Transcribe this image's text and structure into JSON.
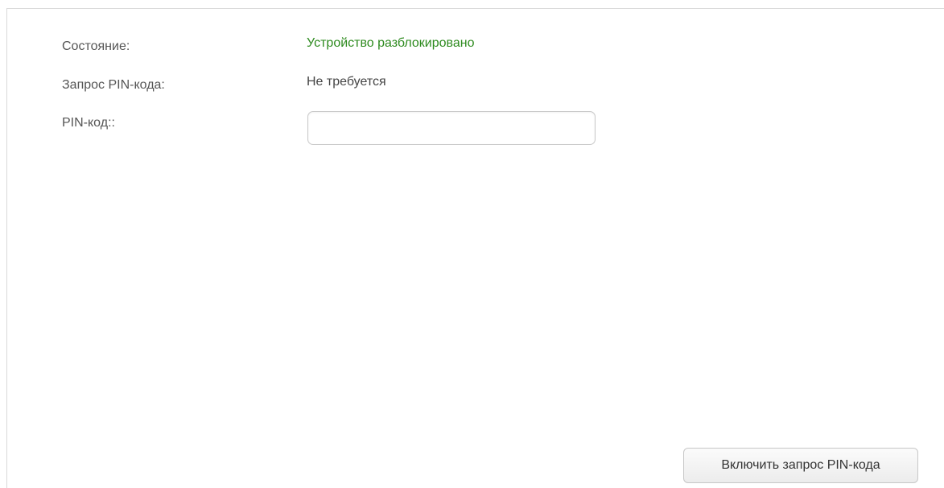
{
  "status": {
    "label": "Состояние:",
    "value": "Устройство разблокировано",
    "value_color": "#2e8b1f"
  },
  "pin_request": {
    "label": "Запрос PIN-кода:",
    "value": "Не требуется"
  },
  "pin_code": {
    "label": "PIN-код::",
    "value": "",
    "placeholder": ""
  },
  "actions": {
    "enable_pin_request_label": "Включить запрос PIN-кода"
  }
}
